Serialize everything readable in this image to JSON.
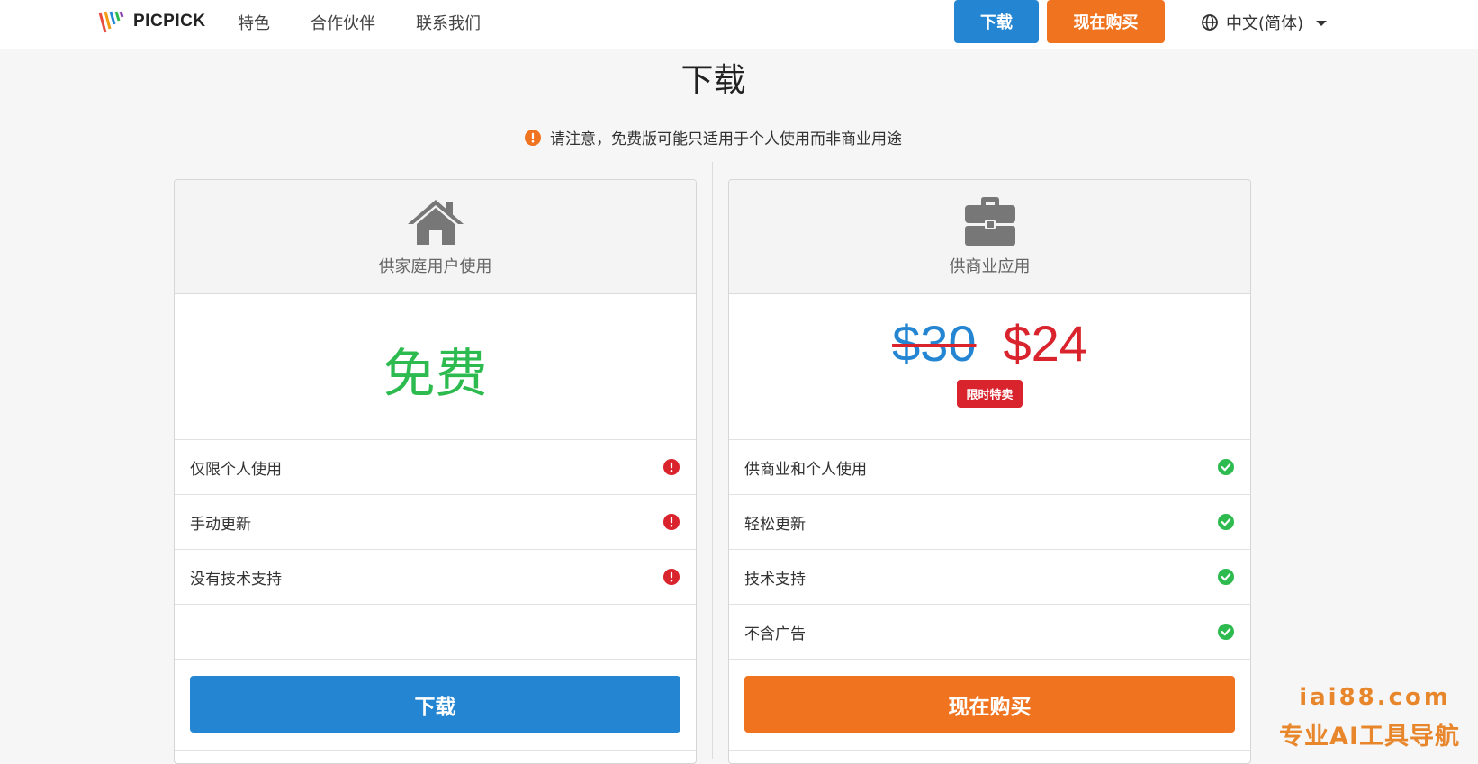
{
  "nav": {
    "brand": "PICPICK",
    "links": [
      "特色",
      "合作伙伴",
      "联系我们"
    ],
    "download_label": "下载",
    "buy_label": "现在购买",
    "language": "中文(简体)"
  },
  "page": {
    "title": "下载",
    "notice": "请注意，免费版可能只适用于个人使用而非商业用途"
  },
  "plans": [
    {
      "title": "供家庭用户使用",
      "icon": "home-icon",
      "price_label": "免费",
      "features": [
        {
          "text": "仅限个人使用",
          "icon": "exclamation-icon"
        },
        {
          "text": "手动更新",
          "icon": "exclamation-icon"
        },
        {
          "text": "没有技术支持",
          "icon": "exclamation-icon"
        }
      ],
      "button_label": "下载"
    },
    {
      "title": "供商业应用",
      "icon": "briefcase-icon",
      "old_price": "$30",
      "new_price": "$24",
      "badge": "限时特卖",
      "features": [
        {
          "text": "供商业和个人使用",
          "icon": "check-icon"
        },
        {
          "text": "轻松更新",
          "icon": "check-icon"
        },
        {
          "text": "技术支持",
          "icon": "check-icon"
        },
        {
          "text": "不含广告",
          "icon": "check-icon"
        }
      ],
      "button_label": "现在购买"
    }
  ],
  "watermark": {
    "url": "iai88.com",
    "text": "专业AI工具导航"
  },
  "colors": {
    "blue": "#2486d2",
    "orange": "#f07320",
    "green": "#2dbb4f",
    "red": "#d9232d"
  }
}
